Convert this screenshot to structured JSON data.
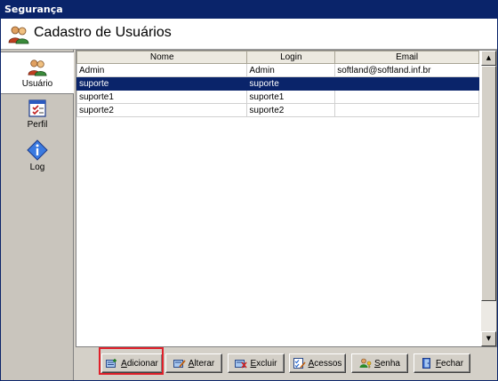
{
  "window": {
    "title": "Segurança"
  },
  "header": {
    "title": "Cadastro de Usuários",
    "icon": "users-icon"
  },
  "sidebar": {
    "items": [
      {
        "label": "Usuário",
        "icon": "users-icon",
        "active": true
      },
      {
        "label": "Perfil",
        "icon": "checklist-icon",
        "active": false
      },
      {
        "label": "Log",
        "icon": "info-diamond-icon",
        "active": false
      }
    ]
  },
  "grid": {
    "columns": [
      "Nome",
      "Login",
      "Email"
    ],
    "rows": [
      {
        "nome": "Admin",
        "login": "Admin",
        "email": "softland@softland.inf.br",
        "selected": false
      },
      {
        "nome": "suporte",
        "login": "suporte",
        "email": "",
        "selected": true
      },
      {
        "nome": "suporte1",
        "login": "suporte1",
        "email": "",
        "selected": false
      },
      {
        "nome": "suporte2",
        "login": "suporte2",
        "email": "",
        "selected": false
      }
    ]
  },
  "toolbar": {
    "adicionar": {
      "first": "A",
      "rest": "dicionar"
    },
    "alterar": {
      "first": "A",
      "rest": "lterar"
    },
    "excluir": {
      "first": "E",
      "rest": "xcluir"
    },
    "acessos": {
      "first": "A",
      "rest": "cessos"
    },
    "senha": {
      "first": "S",
      "rest": "enha"
    },
    "fechar": {
      "first": "F",
      "rest": "echar"
    }
  },
  "colors": {
    "titlebar": "#0a246a",
    "selection": "#0a246a",
    "highlight": "#e0202a"
  }
}
